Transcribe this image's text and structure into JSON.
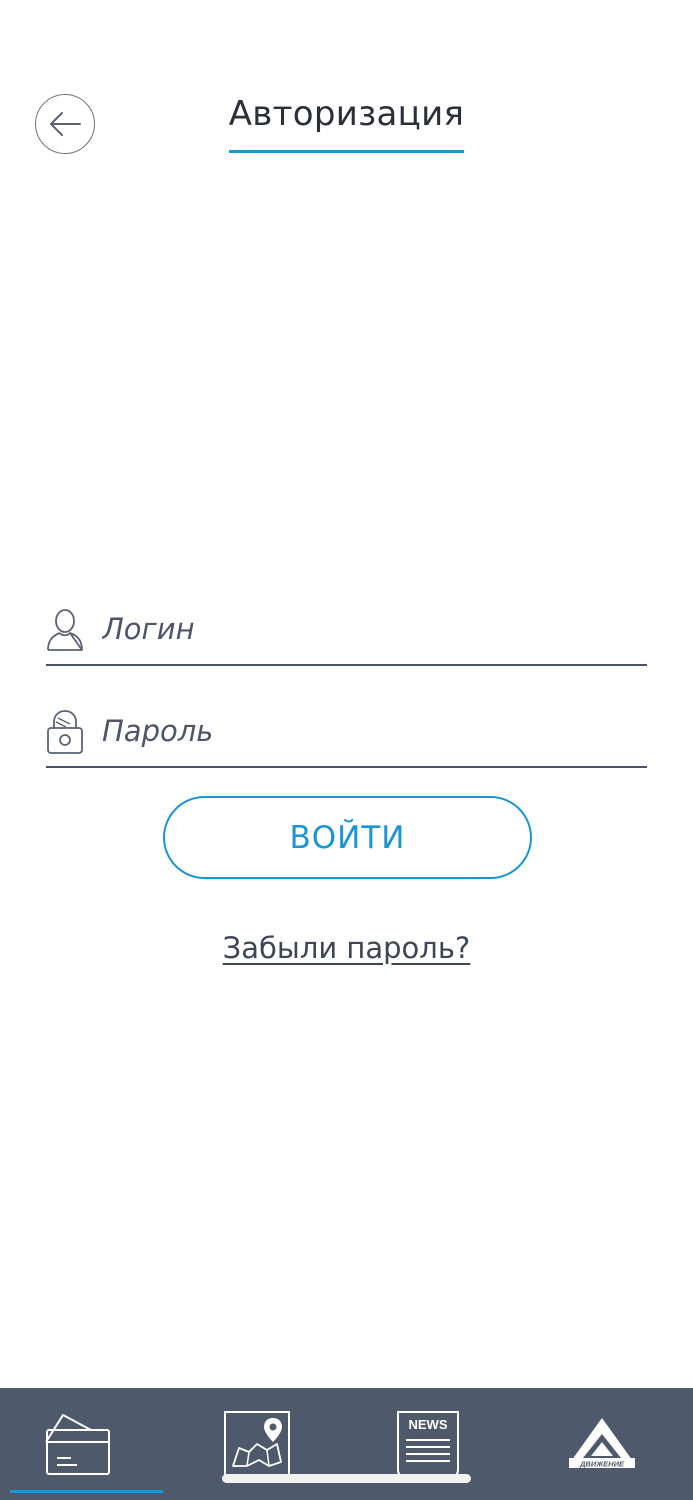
{
  "header": {
    "title": "Авторизация",
    "back_icon": "arrow-left-icon",
    "accent_color": "#1a95d6"
  },
  "form": {
    "login": {
      "placeholder": "Логин",
      "value": "",
      "icon": "user-icon"
    },
    "password": {
      "placeholder": "Пароль",
      "value": "",
      "icon": "lock-icon"
    },
    "submit_label": "ВОЙТИ",
    "forgot_label": "Забыли пароль?"
  },
  "tab_bar": {
    "background": "#4e596b",
    "active_index": 0,
    "tabs": [
      {
        "icon": "card-icon"
      },
      {
        "icon": "map-pin-icon"
      },
      {
        "icon": "news-icon",
        "label": "NEWS"
      },
      {
        "icon": "dvizhenie-logo-icon",
        "label": "ДВИЖЕНИЕ"
      }
    ]
  }
}
